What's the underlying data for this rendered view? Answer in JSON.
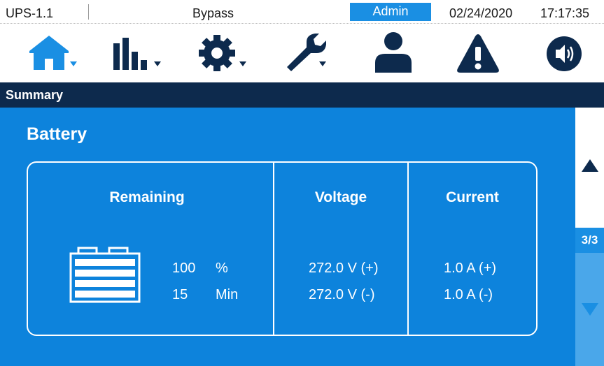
{
  "status_bar": {
    "device": "UPS-1.1",
    "mode": "Bypass",
    "user": "Admin",
    "date": "02/24/2020",
    "time": "17:17:35"
  },
  "toolbar": {
    "items": [
      "home-icon",
      "bar-chart-icon",
      "gear-icon",
      "wrench-icon",
      "user-icon",
      "warning-icon",
      "speaker-icon"
    ]
  },
  "header": {
    "title": "Summary"
  },
  "battery": {
    "title": "Battery",
    "remaining": {
      "label": "Remaining",
      "percent_value": "100",
      "percent_unit": "%",
      "time_value": "15",
      "time_unit": "Min"
    },
    "voltage": {
      "label": "Voltage",
      "positive": "272.0 V (+)",
      "negative": "272.0 V (-)"
    },
    "current": {
      "label": "Current",
      "positive": "1.0 A (+)",
      "negative": "1.0 A (-)"
    }
  },
  "pager": {
    "indicator": "3/3"
  },
  "colors": {
    "accent": "#1a8fe3",
    "panel": "#0d83dc",
    "header": "#0d2a4d",
    "icon": "#0d2a4d"
  }
}
